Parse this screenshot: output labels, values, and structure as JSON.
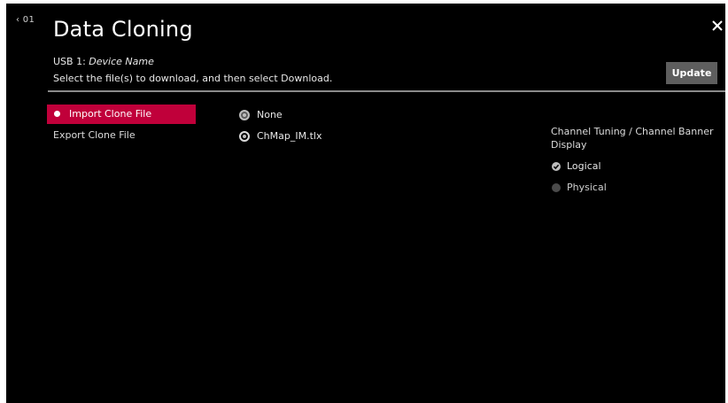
{
  "header": {
    "back_label": "‹ 01",
    "title": "Data Cloning",
    "device_prefix": "USB 1: ",
    "device_name": "Device Name",
    "instruction": "Select the file(s) to download, and then select Download.",
    "update_label": "Update"
  },
  "menu": {
    "items": [
      {
        "label": "Import Clone File",
        "selected": true
      },
      {
        "label": "Export Clone File",
        "selected": false
      }
    ]
  },
  "files": {
    "options": [
      {
        "label": "None",
        "selected": false
      },
      {
        "label": "ChMap_IM.tlx",
        "selected": true
      }
    ]
  },
  "channel_banner": {
    "label": "Channel Tuning / Channel Banner Display",
    "options": [
      {
        "label": "Logical",
        "checked": true,
        "enabled": true
      },
      {
        "label": "Physical",
        "checked": false,
        "enabled": false
      }
    ]
  },
  "colors": {
    "background": "#000000",
    "accent": "#c0003a",
    "button": "#5e5e5e",
    "divider": "#8a8a8a"
  },
  "icons": {
    "back": "chevron-left-icon",
    "close": "close-icon",
    "checked": "check-icon"
  }
}
